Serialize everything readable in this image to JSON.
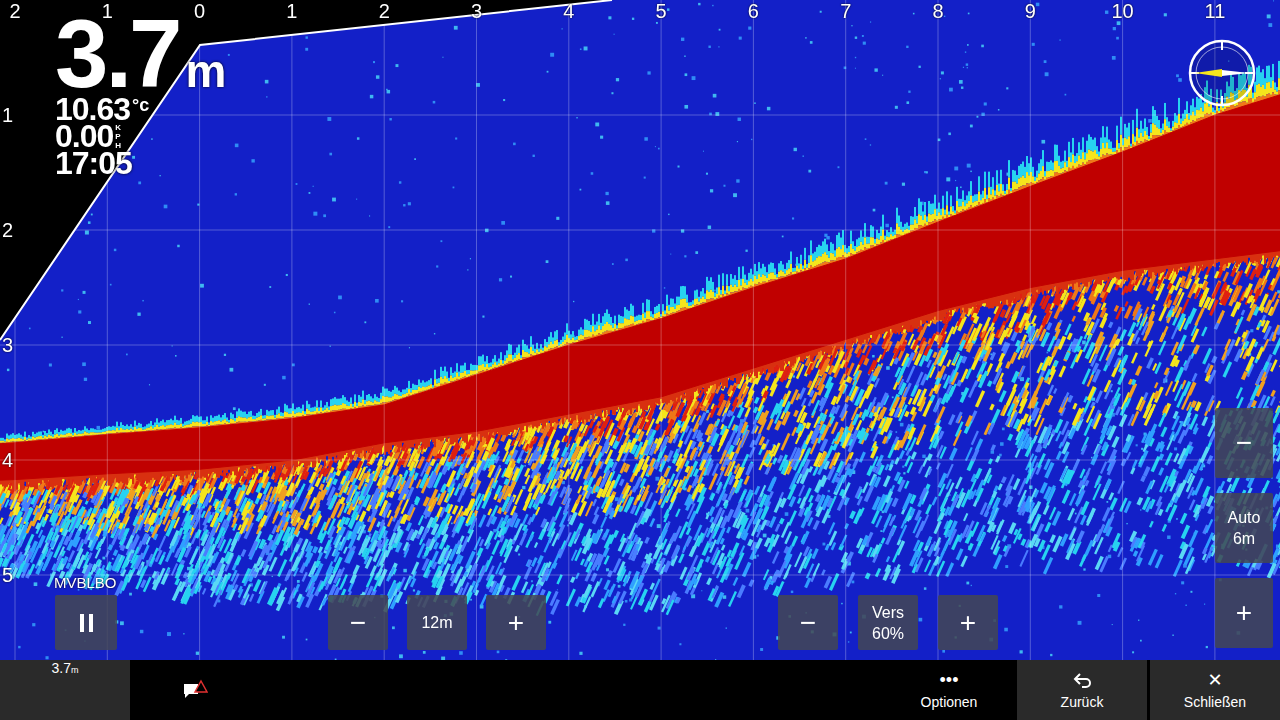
{
  "readout": {
    "depth": "3.7",
    "depth_unit": "m",
    "temperature": "10.63",
    "temperature_unit": "°c",
    "speed": "0.00",
    "speed_unit": "KPH",
    "time": "17:05"
  },
  "scale": {
    "x_ticks": [
      "2",
      "1",
      "0",
      "1",
      "2",
      "3",
      "4",
      "5",
      "6",
      "7",
      "8",
      "9",
      "10",
      "11"
    ],
    "y_ticks": [
      "1",
      "2",
      "3",
      "4",
      "5"
    ]
  },
  "sonar": {
    "x_start": -3,
    "x_step": 1,
    "bottom_top_m": [
      3.9,
      3.85,
      3.78,
      3.72,
      3.64,
      3.52,
      3.26,
      3.0,
      2.77,
      2.5,
      2.25,
      1.93,
      1.62,
      1.32,
      1.0,
      0.75
    ],
    "bottom_bottom_m": [
      4.2,
      4.17,
      4.12,
      4.08,
      4.0,
      3.85,
      3.75,
      3.6,
      3.45,
      3.2,
      2.95,
      2.7,
      2.5,
      2.35,
      2.25,
      2.15
    ]
  },
  "source_label": "MVBLBO",
  "range": {
    "minus": "−",
    "value": "12m",
    "plus": "+"
  },
  "gain": {
    "minus": "−",
    "label": "Vers",
    "value": "60%",
    "plus": "+"
  },
  "zoom": {
    "minus": "−",
    "label": "Auto",
    "value": "6m",
    "plus": "+"
  },
  "bottom_bar": {
    "depth": "3.7",
    "depth_unit": "m",
    "actions": [
      {
        "icon": "•••",
        "label": "Optionen",
        "kind": "text"
      },
      {
        "icon": "",
        "label": "Zurück",
        "kind": "back"
      },
      {
        "icon": "✕",
        "label": "Schließen",
        "kind": "text"
      }
    ]
  }
}
